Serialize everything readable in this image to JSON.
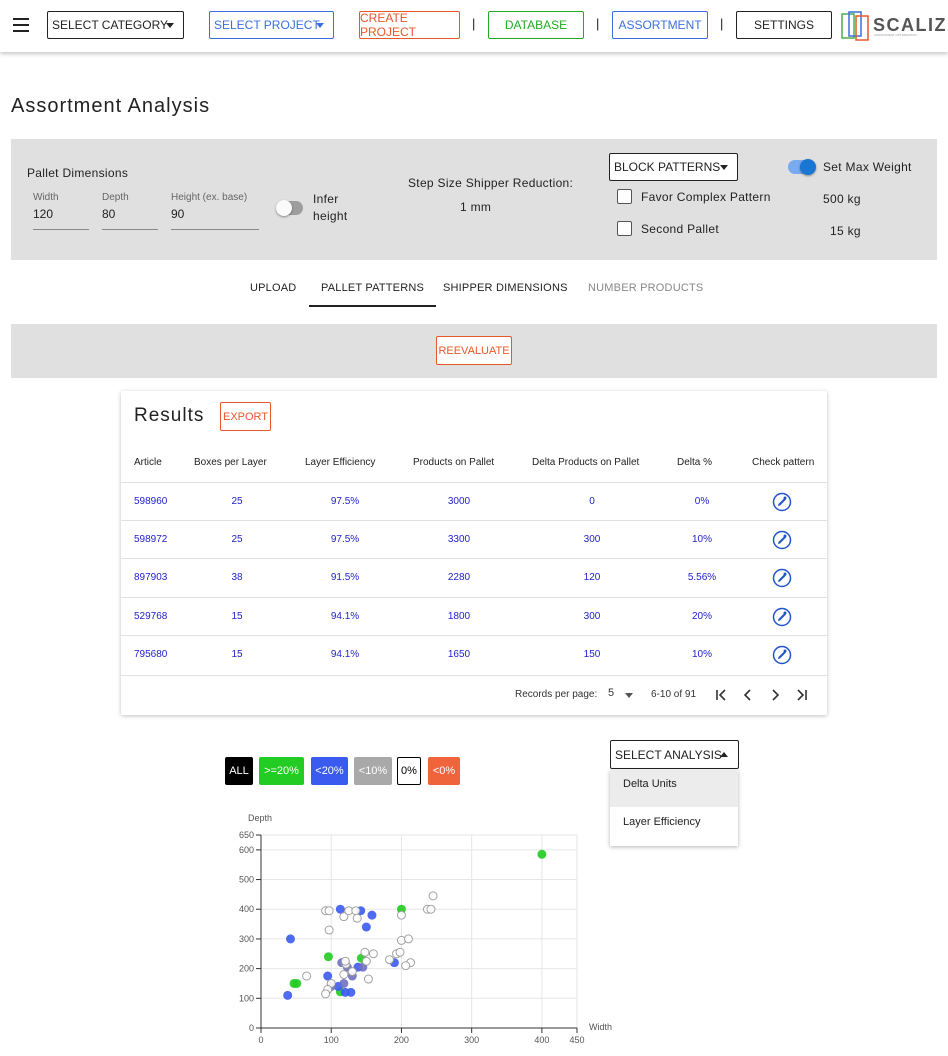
{
  "header": {
    "select_category": "SELECT CATEGORY",
    "select_project": "SELECT PROJECT",
    "create_project": "CREATE PROJECT",
    "database": "DATABASE",
    "assortment": "ASSORTMENT",
    "settings": "SETTINGS",
    "separator": "|",
    "logo_text": "SCALIZE",
    "logo_sub": "ASSORTMENT OPTIMIZATION"
  },
  "page_title": "Assortment Analysis",
  "settings": {
    "pallet_dimensions_label": "Pallet Dimensions",
    "width_label": "Width",
    "width_value": "120",
    "depth_label": "Depth",
    "depth_value": "80",
    "height_label": "Height (ex. base)",
    "height_value": "90",
    "infer_height_line1": "Infer",
    "infer_height_line2": "height",
    "infer_height_on": false,
    "step_size_label": "Step Size Shipper Reduction:",
    "step_size_value": "1 mm",
    "block_patterns": "BLOCK PATTERNS",
    "favor_complex": "Favor Complex Pattern",
    "favor_complex_checked": false,
    "second_pallet": "Second Pallet",
    "second_pallet_checked": false,
    "set_max_weight": "Set Max Weight",
    "set_max_weight_on": true,
    "max_weight_1": "500 kg",
    "max_weight_2": "15 kg"
  },
  "tabs": [
    {
      "label": "UPLOAD",
      "active": false,
      "disabled": false
    },
    {
      "label": "PALLET PATTERNS",
      "active": true,
      "disabled": false
    },
    {
      "label": "SHIPPER DIMENSIONS",
      "active": false,
      "disabled": false
    },
    {
      "label": "NUMBER PRODUCTS",
      "active": false,
      "disabled": true
    }
  ],
  "reevaluate_label": "REEVALUATE",
  "results": {
    "title": "Results",
    "export_label": "EXPORT",
    "columns": [
      "Article",
      "Boxes per Layer",
      "Layer Efficiency",
      "Products on Pallet",
      "Delta Products on Pallet",
      "Delta %",
      "Check pattern"
    ],
    "rows": [
      [
        "598960",
        "25",
        "97.5%",
        "3000",
        "0",
        "0%"
      ],
      [
        "598972",
        "25",
        "97.5%",
        "3300",
        "300",
        "10%"
      ],
      [
        "897903",
        "38",
        "91.5%",
        "2280",
        "120",
        "5.56%"
      ],
      [
        "529768",
        "15",
        "94.1%",
        "1800",
        "300",
        "20%"
      ],
      [
        "795680",
        "15",
        "94.1%",
        "1650",
        "150",
        "10%"
      ]
    ],
    "records_per_page_label": "Records per page:",
    "records_per_page": "5",
    "range_text": "6-10 of 91"
  },
  "filters": [
    {
      "label": "ALL",
      "bg": "#000000",
      "fg": "#ffffff",
      "border": "#000000"
    },
    {
      "label": ">=20%",
      "bg": "#22cc22",
      "fg": "#ffffff",
      "border": "#22cc22"
    },
    {
      "label": "<20%",
      "bg": "#3b5bf0",
      "fg": "#ffffff",
      "border": "#3b5bf0"
    },
    {
      "label": "<10%",
      "bg": "#a9a9a9",
      "fg": "#ffffff",
      "border": "#a9a9a9"
    },
    {
      "label": "0%",
      "bg": "#ffffff",
      "fg": "#000000",
      "border": "#000000"
    },
    {
      "label": "<0%",
      "bg": "#f0643c",
      "fg": "#ffffff",
      "border": "#f0643c"
    }
  ],
  "analysis": {
    "select_label": "SELECT ANALYSIS",
    "options": [
      "Delta Units",
      "Layer Efficiency"
    ]
  },
  "chart_data": {
    "type": "scatter",
    "xlabel": "Width",
    "ylabel": "Depth",
    "xlim": [
      0,
      450
    ],
    "ylim": [
      0,
      650
    ],
    "xticks": [
      0,
      100,
      200,
      300,
      400,
      450
    ],
    "yticks": [
      0,
      100,
      200,
      300,
      400,
      500,
      600,
      650
    ],
    "grid": true,
    "series": [
      {
        "color": "#22cc22",
        "points": [
          [
            400,
            585
          ],
          [
            143,
            235
          ],
          [
            96,
            240
          ],
          [
            113,
            122
          ],
          [
            47,
            150
          ],
          [
            51,
            150
          ],
          [
            200,
            400
          ]
        ]
      },
      {
        "color": "#3b5bf0",
        "points": [
          [
            42,
            300
          ],
          [
            113,
            400
          ],
          [
            142,
            395
          ],
          [
            158,
            380
          ],
          [
            150,
            340
          ],
          [
            190,
            220
          ],
          [
            138,
            205
          ],
          [
            95,
            175
          ],
          [
            128,
            120
          ],
          [
            120,
            120
          ],
          [
            38,
            110
          ],
          [
            110,
            140
          ]
        ]
      },
      {
        "color": "#6f6fc4",
        "points": [
          [
            118,
            150
          ],
          [
            130,
            175
          ],
          [
            145,
            205
          ],
          [
            123,
            205
          ],
          [
            115,
            220
          ],
          [
            100,
            140
          ]
        ]
      },
      {
        "color": "#bbbbbb",
        "points": [
          [
            92,
            395
          ],
          [
            97,
            395
          ],
          [
            118,
            375
          ],
          [
            125,
            395
          ],
          [
            135,
            395
          ],
          [
            137,
            370
          ],
          [
            97,
            330
          ],
          [
            121,
            215
          ],
          [
            120,
            225
          ],
          [
            150,
            225
          ],
          [
            160,
            250
          ],
          [
            183,
            230
          ],
          [
            193,
            250
          ],
          [
            198,
            255
          ],
          [
            200,
            295
          ],
          [
            210,
            300
          ],
          [
            213,
            220
          ],
          [
            206,
            210
          ],
          [
            245,
            445
          ],
          [
            237,
            400
          ],
          [
            242,
            400
          ],
          [
            200,
            380
          ],
          [
            130,
            190
          ],
          [
            118,
            180
          ],
          [
            153,
            165
          ],
          [
            100,
            150
          ],
          [
            95,
            130
          ],
          [
            92,
            115
          ],
          [
            65,
            175
          ],
          [
            148,
            255
          ]
        ]
      }
    ]
  }
}
